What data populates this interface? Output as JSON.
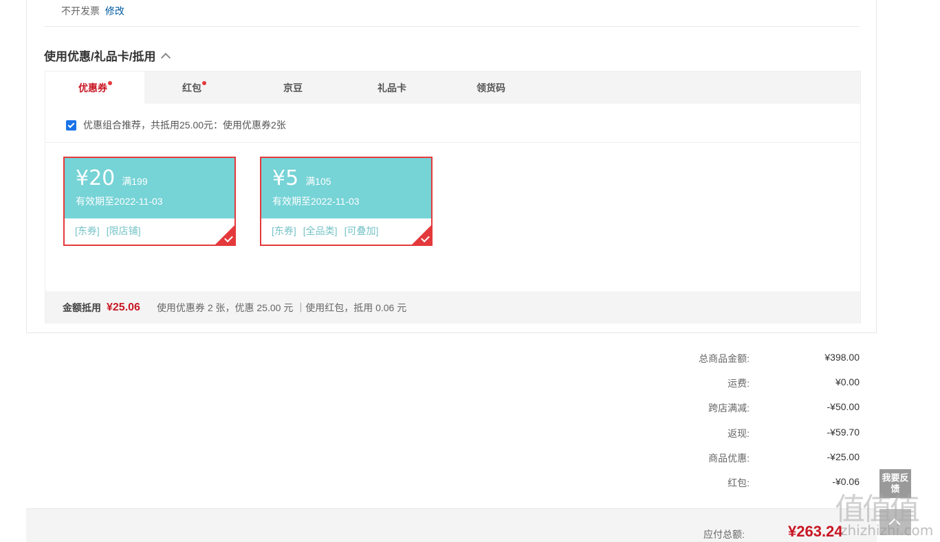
{
  "invoice": {
    "text": "不开发票",
    "modify_link": "修改"
  },
  "discount_section": {
    "title": "使用优惠/礼品卡/抵用",
    "tabs": [
      {
        "label": "优惠券",
        "has_dot": true,
        "active": true
      },
      {
        "label": "红包",
        "has_dot": true,
        "active": false
      },
      {
        "label": "京豆",
        "has_dot": false,
        "active": false
      },
      {
        "label": "礼品卡",
        "has_dot": false,
        "active": false
      },
      {
        "label": "领货码",
        "has_dot": false,
        "active": false
      }
    ],
    "combo_recommend": {
      "checked": true,
      "text": "优惠组合推荐，共抵用25.00元：使用优惠券2张"
    },
    "coupons": [
      {
        "amount": "¥20",
        "condition": "满199",
        "validity": "有效期至2022-11-03",
        "tags": [
          "[东券]",
          "[限店铺]"
        ],
        "selected": true
      },
      {
        "amount": "¥5",
        "condition": "满105",
        "validity": "有效期至2022-11-03",
        "tags": [
          "[东券]",
          "[全品类]",
          "[可叠加]"
        ],
        "selected": true
      }
    ],
    "summary": {
      "label": "金额抵用",
      "total": "¥25.06",
      "detail": "使用优惠券 2 张，优惠 25.00 元 ｜使用红包，抵用 0.06 元"
    }
  },
  "price_breakdown": [
    {
      "label": "总商品金额:",
      "value": "¥398.00"
    },
    {
      "label": "运费:",
      "value": "¥0.00"
    },
    {
      "label": "跨店满减:",
      "value": "-¥50.00"
    },
    {
      "label": "返现:",
      "value": "-¥59.70"
    },
    {
      "label": "商品优惠:",
      "value": "-¥25.00"
    },
    {
      "label": "红包:",
      "value": "-¥0.06"
    }
  ],
  "payable": {
    "label": "应付总额:",
    "value": "¥263.24"
  },
  "sidebar": {
    "feedback_label": "我要反馈"
  },
  "watermark": {
    "text": "值值值",
    "sub": "zhizhizhi.com"
  },
  "colors": {
    "accent_red": "#e4393c",
    "coupon_teal": "#76d3d6",
    "link_blue": "#005aa0"
  }
}
